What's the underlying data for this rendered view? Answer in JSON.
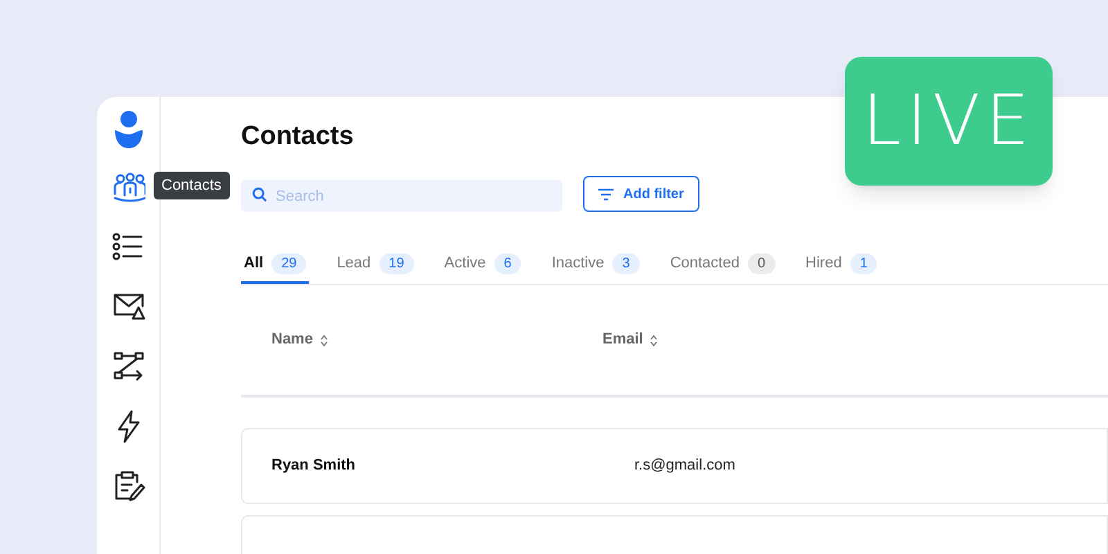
{
  "live_badge": "LIVE",
  "sidebar": {
    "items": [
      {
        "kind": "contacts",
        "selected": true,
        "tooltip": "Contacts"
      },
      {
        "kind": "list",
        "selected": false
      },
      {
        "kind": "mail",
        "selected": false
      },
      {
        "kind": "flow",
        "selected": false
      },
      {
        "kind": "bolt",
        "selected": false
      },
      {
        "kind": "clipboard",
        "selected": false
      }
    ]
  },
  "title": "Contacts",
  "search": {
    "placeholder": "Search"
  },
  "add_filter_button": "Add filter",
  "tabs": [
    {
      "label": "All",
      "count": "29",
      "selected": true,
      "emphasized": true
    },
    {
      "label": "Lead",
      "count": "19",
      "selected": false,
      "emphasized": true
    },
    {
      "label": "Active",
      "count": "6",
      "selected": false,
      "emphasized": true
    },
    {
      "label": "Inactive",
      "count": "3",
      "selected": false,
      "emphasized": true
    },
    {
      "label": "Contacted",
      "count": "0",
      "selected": false,
      "emphasized": false
    },
    {
      "label": "Hired",
      "count": "1",
      "selected": false,
      "emphasized": true
    }
  ],
  "table": {
    "columns": [
      "Name",
      "Email"
    ],
    "rows": [
      {
        "name": "Ryan Smith",
        "email": "r.s@gmail.com"
      }
    ]
  }
}
